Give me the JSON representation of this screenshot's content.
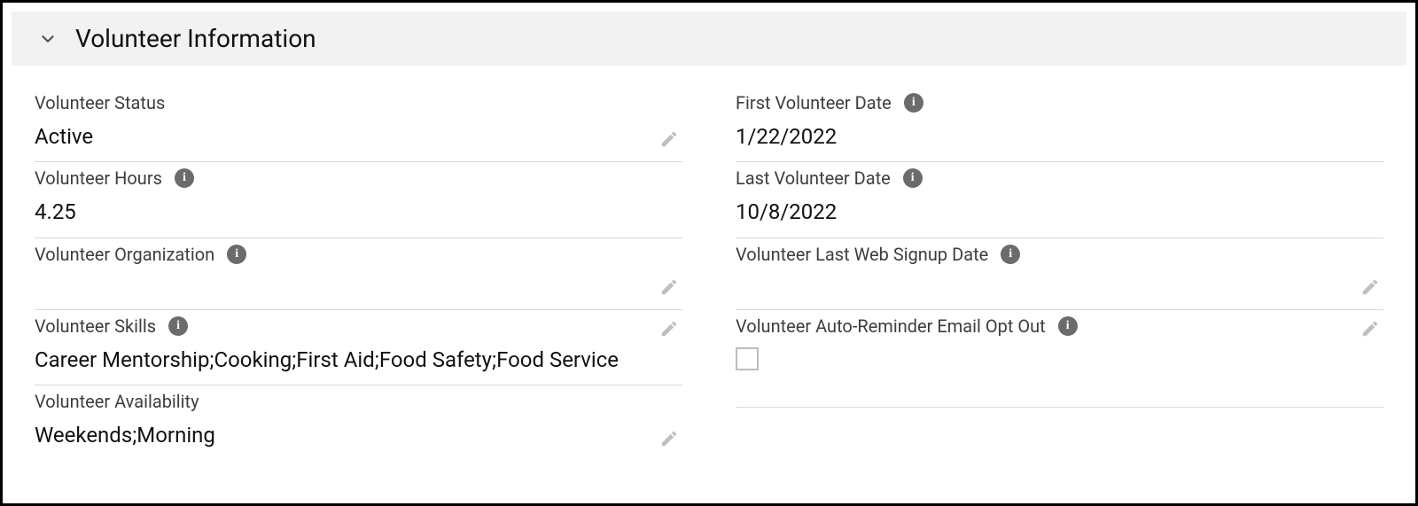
{
  "section": {
    "title": "Volunteer Information"
  },
  "left": {
    "volunteer_status": {
      "label": "Volunteer Status",
      "value": "Active"
    },
    "volunteer_hours": {
      "label": "Volunteer Hours",
      "value": "4.25"
    },
    "volunteer_organization": {
      "label": "Volunteer Organization",
      "value": ""
    },
    "volunteer_skills": {
      "label": "Volunteer Skills",
      "value": "Career Mentorship;Cooking;First Aid;Food Safety;Food Service"
    },
    "volunteer_availability": {
      "label": "Volunteer Availability",
      "value": "Weekends;Morning"
    }
  },
  "right": {
    "first_volunteer_date": {
      "label": "First Volunteer Date",
      "value": "1/22/2022"
    },
    "last_volunteer_date": {
      "label": "Last Volunteer Date",
      "value": "10/8/2022"
    },
    "last_web_signup_date": {
      "label": "Volunteer Last Web Signup Date",
      "value": ""
    },
    "auto_reminder_opt_out": {
      "label": "Volunteer Auto-Reminder Email Opt Out",
      "checked": false
    }
  }
}
